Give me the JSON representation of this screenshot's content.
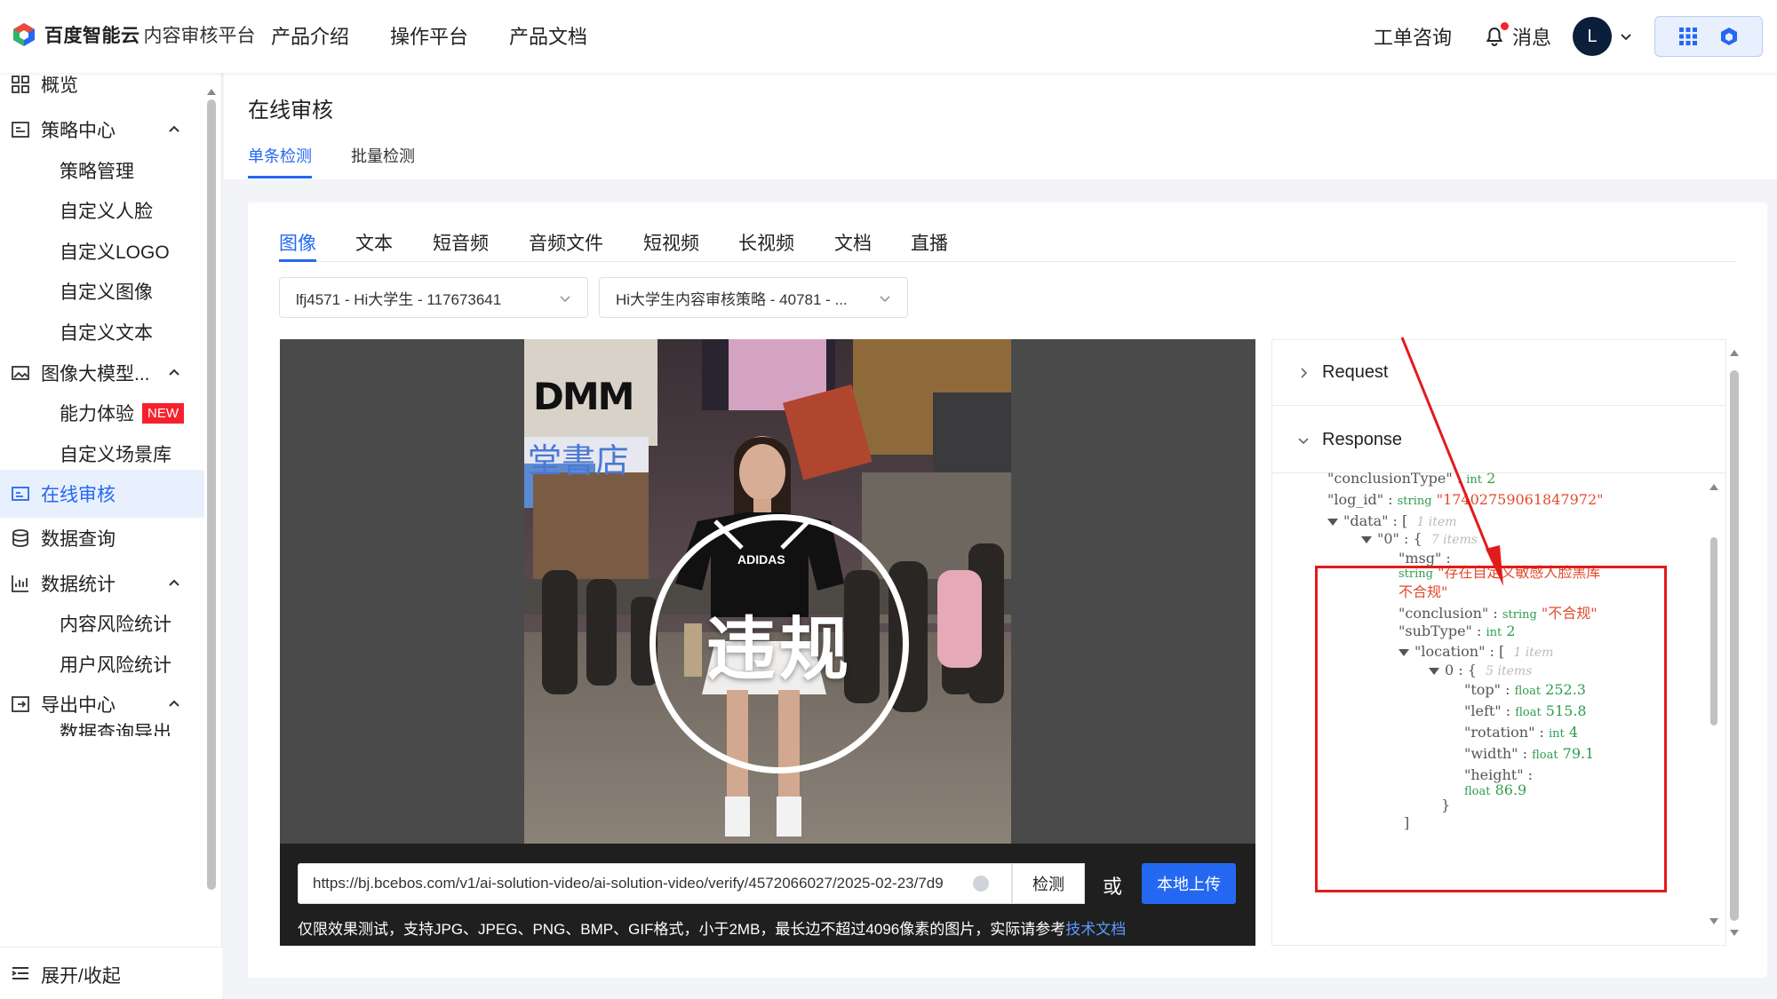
{
  "brand": {
    "name": "百度智能云",
    "product": "内容审核平台"
  },
  "topnav": [
    "产品介绍",
    "操作平台",
    "产品文档"
  ],
  "topright": {
    "ticket": "工单咨询",
    "messages": "消息",
    "avatar_letter": "L"
  },
  "sidebar": {
    "items": [
      {
        "label": "概览",
        "icon": "grid-icon"
      },
      {
        "label": "策略中心",
        "icon": "strategy-icon"
      },
      {
        "label": "策略管理"
      },
      {
        "label": "自定义人脸"
      },
      {
        "label": "自定义LOGO"
      },
      {
        "label": "自定义图像"
      },
      {
        "label": "自定义文本"
      },
      {
        "label": "图像大模型...",
        "icon": "image-model-icon"
      },
      {
        "label": "能力体验",
        "badge": "NEW"
      },
      {
        "label": "自定义场景库"
      },
      {
        "label": "在线审核",
        "icon": "online-review-icon",
        "active": true
      },
      {
        "label": "数据查询",
        "icon": "database-icon"
      },
      {
        "label": "数据统计",
        "icon": "chart-icon"
      },
      {
        "label": "内容风险统计"
      },
      {
        "label": "用户风险统计"
      },
      {
        "label": "导出中心",
        "icon": "export-icon"
      },
      {
        "label": "数据查询导出"
      }
    ],
    "toggle": "展开/收起"
  },
  "page": {
    "title": "在线审核",
    "tabs": [
      "单条检测",
      "批量检测"
    ],
    "active_tab": "单条检测"
  },
  "content_tabs": [
    "图像",
    "文本",
    "短音频",
    "音频文件",
    "短视频",
    "长视频",
    "文档",
    "直播"
  ],
  "selects": {
    "app": "lfj4571 - Hi大学生 - 117673641",
    "strategy": "Hi大学生内容审核策略 - 40781 - ..."
  },
  "viewer": {
    "photo_signs": {
      "dmm": "DMM",
      "store": "堂書店",
      "shirt": "ADIDAS"
    },
    "verdict": "违规",
    "url": "https://bj.bcebos.com/v1/ai-solution-video/ai-solution-video/verify/4572066027/2025-02-23/7d9",
    "detect": "检测",
    "or": "或",
    "upload": "本地上传",
    "hint": "仅限效果测试，支持JPG、JPEG、PNG、BMP、GIF格式，小于2MB，最长边不超过4096像素的图片，实际请参考",
    "hint_link": "技术文档"
  },
  "json_panel": {
    "request": "Request",
    "response": "Response",
    "conclusionType_key": "\"conclusionType\"",
    "conclusionType_type": "int",
    "conclusionType_val": "2",
    "log_id_key": "\"log_id\"",
    "log_id_type": "string",
    "log_id_val": "\"17402759061847972\"",
    "data_key": "\"data\"",
    "data_count": "1 item",
    "idx0_key": "\"0\"",
    "idx0_count": "7 items",
    "msg_key": "\"msg\"",
    "msg_type": "string",
    "msg_val": "\"存在自定义敏感人脸黑库不合规\"",
    "conclusion_key": "\"conclusion\"",
    "conclusion_type": "string",
    "conclusion_val": "\"不合规\"",
    "subType_key": "\"subType\"",
    "subType_type": "int",
    "subType_val": "2",
    "location_key": "\"location\"",
    "location_count": "1 item",
    "loc0_key": "0",
    "loc0_count": "5 items",
    "top_key": "\"top\"",
    "top_val": "252.3",
    "left_key": "\"left\"",
    "left_val": "515.8",
    "rotation_key": "\"rotation\"",
    "rotation_val": "4",
    "width_key": "\"width\"",
    "width_val": "79.1",
    "height_key": "\"height\"",
    "height_val": "86.9",
    "float_type": "float",
    "int_type": "int"
  },
  "colors": {
    "accent": "#2468f2",
    "annotation": "#e21b1b",
    "badge": "#f5222d"
  }
}
